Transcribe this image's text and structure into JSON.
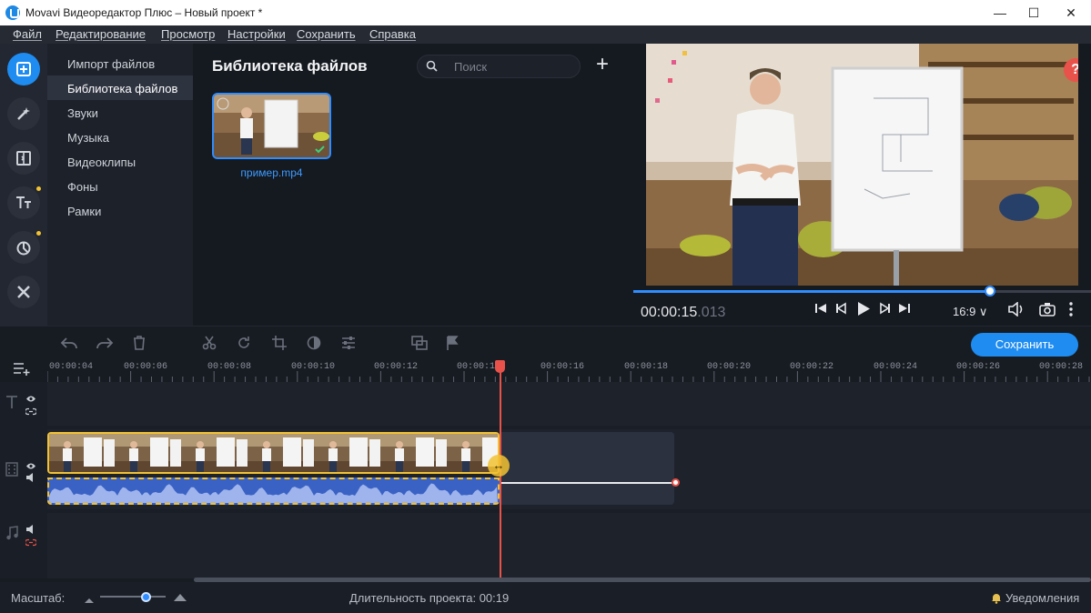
{
  "window": {
    "title": "Movavi Видеоредактор Плюс – Новый проект *",
    "minimize": "—",
    "maximize": "☐",
    "close": "✕"
  },
  "menu": [
    "Файл",
    "Редактирование",
    "Просмотр",
    "Настройки",
    "Сохранить",
    "Справка"
  ],
  "categories": {
    "items": [
      "Импорт файлов",
      "Библиотека файлов",
      "Звуки",
      "Музыка",
      "Видеоклипы",
      "Фоны",
      "Рамки"
    ],
    "active": "Библиотека файлов"
  },
  "library": {
    "title": "Библиотека файлов",
    "search_placeholder": "Поиск",
    "add": "+",
    "clip_name": "пример.mp4"
  },
  "preview": {
    "help": "?",
    "timecode": "00:00:15",
    "timecode_ms": ".013",
    "progress": 0.78,
    "aspect": "16:9 ∨"
  },
  "toolbar": {
    "save_label": "Сохранить"
  },
  "ruler": {
    "ticks": [
      "00:00:04",
      "00:00:06",
      "00:00:08",
      "00:00:10",
      "00:00:12",
      "00:00:1",
      "00:00:16",
      "00:00:18",
      "00:00:20",
      "00:00:22",
      "00:00:24",
      "00:00:26",
      "00:00:28"
    ]
  },
  "status": {
    "scale_label": "Масштаб:",
    "duration": "Длительность проекта:  00:19",
    "notifications": "Уведомления"
  },
  "colors": {
    "accent": "#1e8cf0",
    "clip_border": "#f2c232",
    "playhead": "#e9524a",
    "audio": "#3a62c5"
  },
  "icons": {
    "rail": [
      "import-icon",
      "magic-wand-icon",
      "transitions-icon",
      "titles-icon",
      "stickers-icon",
      "tools-icon"
    ],
    "toolbar": [
      "undo-icon",
      "redo-icon",
      "delete-icon",
      "cut-icon",
      "rotate-icon",
      "crop-icon",
      "color-icon",
      "adjust-icon",
      "overlay-icon",
      "marker-icon"
    ]
  }
}
